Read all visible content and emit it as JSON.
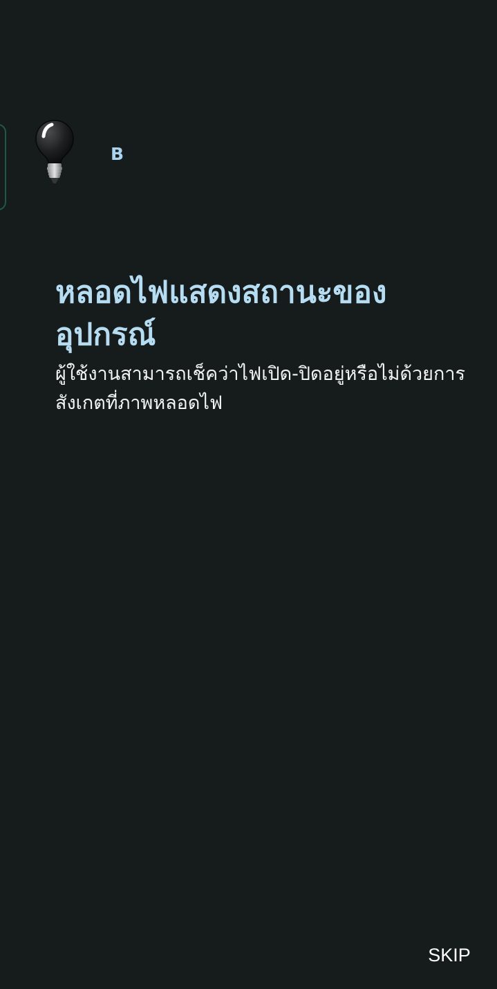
{
  "device": {
    "icon": "light-bulb-icon",
    "letter": "B",
    "accent_color": "#1f5a48"
  },
  "onboarding": {
    "title": "หลอดไฟแสดงสถานะของอุปกรณ์",
    "description": "ผู้ใช้งานสามารถเช็คว่าไฟเปิด-ปิดอยู่หรือไม่ด้วยการสังเกตที่ภาพหลอดไฟ",
    "title_color": "#b6dcf2"
  },
  "actions": {
    "skip_label": "SKIP"
  },
  "theme": {
    "background": "#161b1c"
  }
}
